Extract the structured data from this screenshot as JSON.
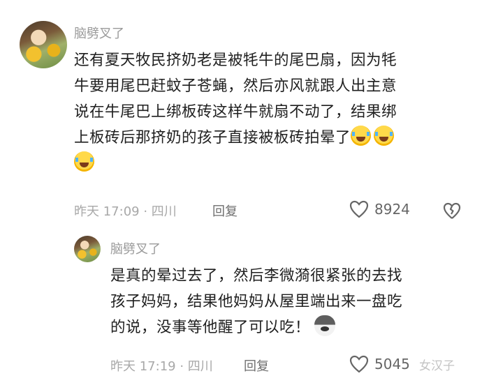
{
  "comment": {
    "username": "脑劈叉了",
    "lines": [
      "还有夏天牧民挤奶老是被牦牛的尾巴扇，因为牦",
      "牛要用尾巴赶蚊子苍蝇，然后亦风就跟人出主意",
      "说在牛尾巴上绑板砖这样牛就扇不动了，结果绑",
      "上板砖后那挤奶的孩子直接被板砖拍晕了"
    ],
    "time_location": "昨天 17:09 · 四川",
    "reply_label": "回复",
    "likes": "8924",
    "emojis": [
      "crying-laughing-emoji",
      "crying-laughing-emoji",
      "crying-laughing-emoji"
    ]
  },
  "reply": {
    "username": "脑劈叉了",
    "lines": [
      "是真的晕过去了，然后李微漪很紧张的去找",
      "孩子妈妈，结果他妈妈从屋里端出来一盘吃",
      "的说，没事等他醒了可以吃！"
    ],
    "time_location": "昨天 17:19 · 四川",
    "reply_label": "回复",
    "likes": "5045",
    "emoji": "husky-dog-emoji"
  },
  "watermark": "女汉子"
}
